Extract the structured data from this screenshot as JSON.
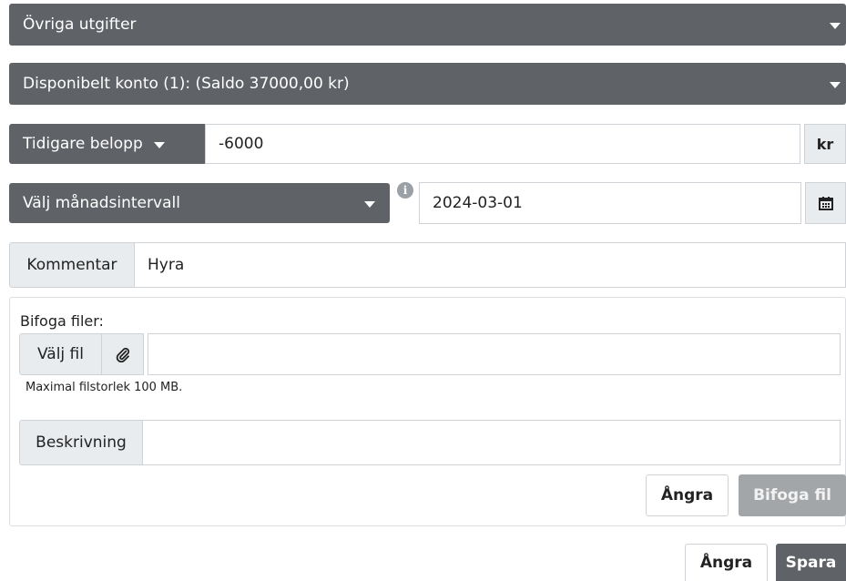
{
  "category_select": {
    "label": "Övriga utgifter"
  },
  "account_select": {
    "label": "Disponibelt konto (1): (Saldo 37000,00 kr)"
  },
  "amount": {
    "type_label": "Tidigare belopp",
    "value": "-6000",
    "unit": "kr"
  },
  "interval": {
    "label": "Välj månadsintervall",
    "info_icon": "info-icon",
    "date_value": "2024-03-01",
    "calendar_icon": "calendar-icon"
  },
  "comment": {
    "label": "Kommentar",
    "value": "Hyra"
  },
  "attach": {
    "heading": "Bifoga filer:",
    "choose_label": "Välj fil",
    "paperclip_icon": "paperclip-icon",
    "file_value": "",
    "max_size_text": "Maximal filstorlek 100 MB.",
    "description_label": "Beskrivning",
    "description_value": "",
    "undo_label": "Ångra",
    "attach_label": "Bifoga fil"
  },
  "footer": {
    "undo_label": "Ångra",
    "save_label": "Spara"
  }
}
